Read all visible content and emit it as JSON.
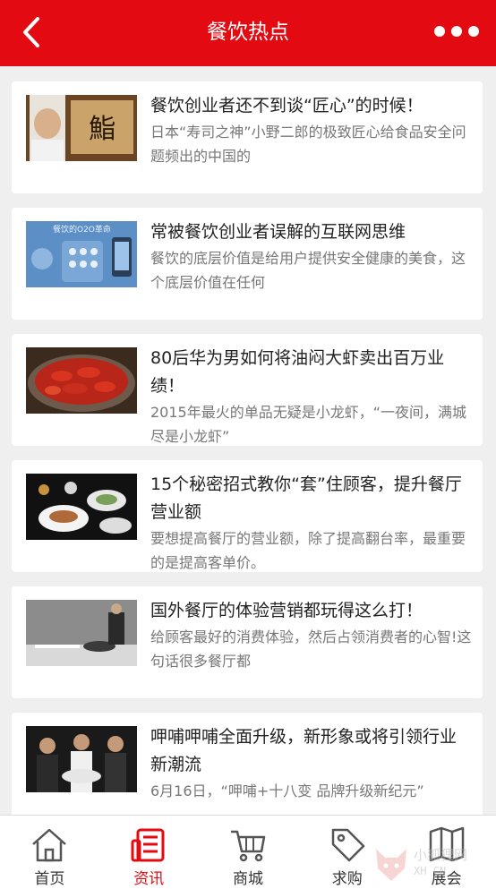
{
  "header": {
    "title": "餐饮热点",
    "back_icon": "chevron-left-icon",
    "more_icon": "more-dots-icon",
    "background_color": "#e40a12"
  },
  "articles": [
    {
      "title": "餐饮创业者还不到谈“匠心”的时候！",
      "desc": "日本“寿司之神”小野二郎的极致匠心给食品安全问题频出的中国的",
      "thumb_text": "鮨"
    },
    {
      "title": "常被餐饮创业者误解的互联网思维",
      "desc": "餐饮的底层价值是给用户提供安全健康的美食，这个底层价值在任何",
      "thumb_text": "餐饮的O2O革命"
    },
    {
      "title": "80后华为男如何将油闷大虾卖出百万业绩！",
      "desc": "2015年最火的单品无疑是小龙虾，“一夜间，满城尽是小龙虾”"
    },
    {
      "title": "15个秘密招式教你“套”住顾客，提升餐厅营业额",
      "desc": "要想提高餐厅的营业额，除了提高翻台率，最重要的是提高客单价。"
    },
    {
      "title": "国外餐厅的体验营销都玩得这么打！",
      "desc": "给顾客最好的消费体验，然后占领消费者的心智!这句话很多餐厅都"
    },
    {
      "title": "呷哺呷哺全面升级，新形象或将引领行业新潮流",
      "desc": "6月16日，“呷哺+十八变 品牌升级新纪元”"
    }
  ],
  "tabs": [
    {
      "label": "首页",
      "icon": "home-icon",
      "active": false
    },
    {
      "label": "资讯",
      "icon": "news-icon",
      "active": true
    },
    {
      "label": "商城",
      "icon": "cart-icon",
      "active": false
    },
    {
      "label": "求购",
      "icon": "tag-icon",
      "active": false
    },
    {
      "label": "展会",
      "icon": "map-icon",
      "active": false
    }
  ],
  "watermark": {
    "text": "小狐狸网",
    "sub": "XH   CN"
  },
  "colors": {
    "accent": "#e40a12",
    "text": "#222222",
    "muted": "#777777"
  }
}
